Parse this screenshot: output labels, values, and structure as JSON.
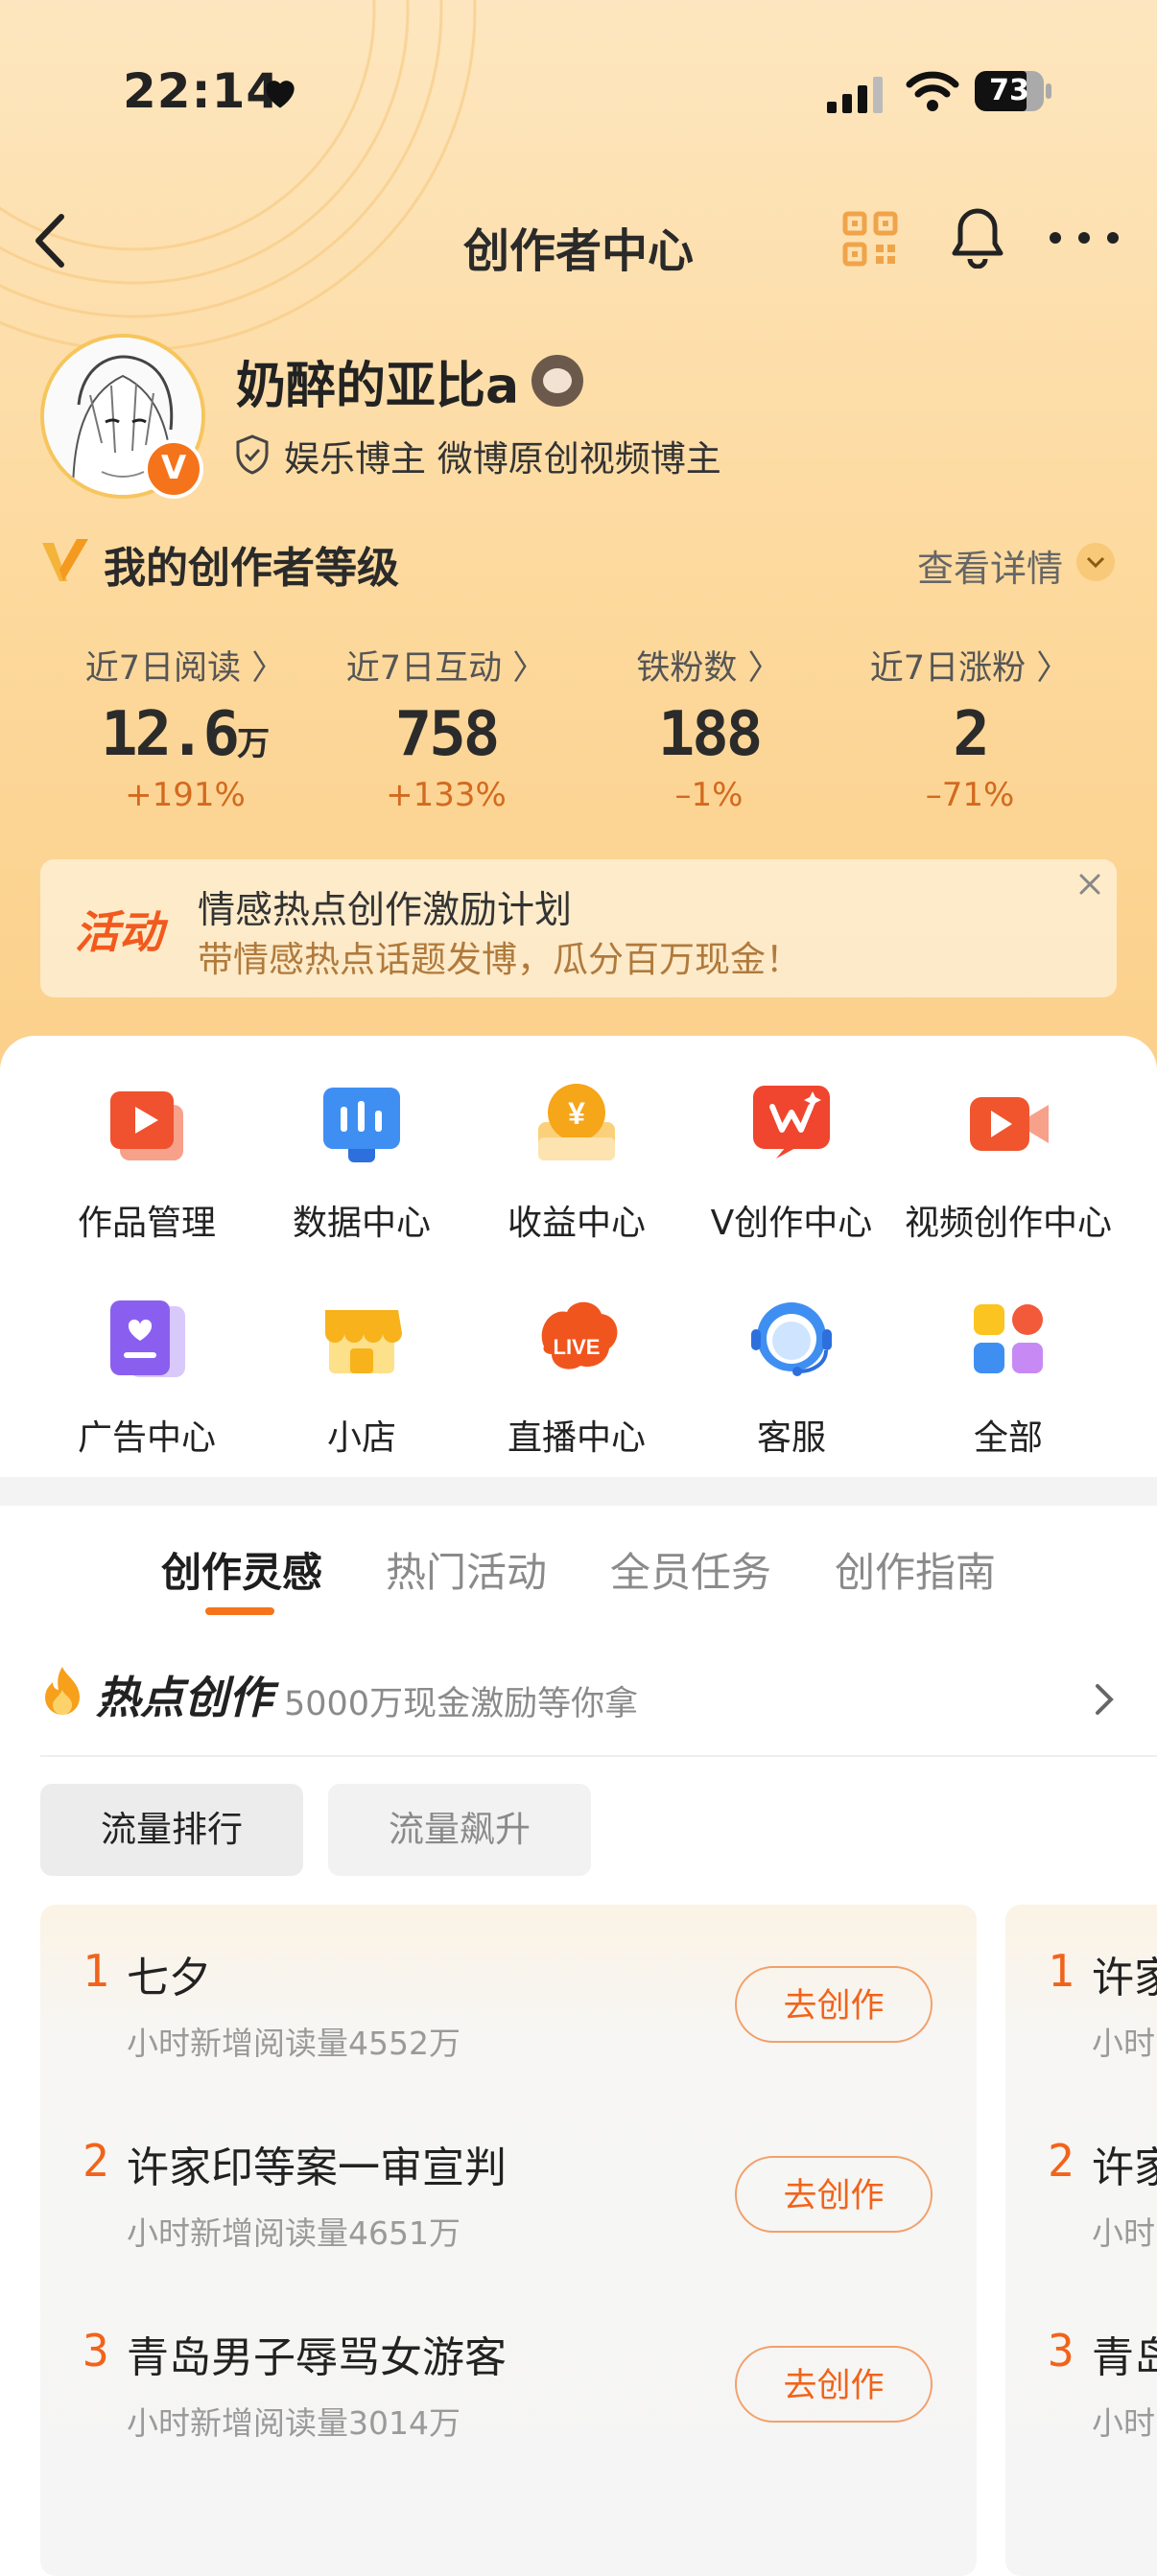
{
  "status_bar": {
    "time": "22:14",
    "battery": "73"
  },
  "nav": {
    "title": "创作者中心"
  },
  "profile": {
    "username": "奶醉的亚比a",
    "verified_badge": "V",
    "tags": "娱乐博主 微博原创视频博主"
  },
  "level": {
    "title": "我的创作者等级",
    "detail_link": "查看详情"
  },
  "stats": [
    {
      "label": "近7日阅读 〉",
      "value": "12.6",
      "unit": "万",
      "change": "+191%"
    },
    {
      "label": "近7日互动 〉",
      "value": "758",
      "unit": "",
      "change": "+133%"
    },
    {
      "label": "铁粉数 〉",
      "value": "188",
      "unit": "",
      "change": "–1%"
    },
    {
      "label": "近7日涨粉 〉",
      "value": "2",
      "unit": "",
      "change": "–71%"
    }
  ],
  "banner": {
    "tag": "活动",
    "title": "情感热点创作激励计划",
    "subtitle": "带情感热点话题发博，瓜分百万现金！"
  },
  "menu": [
    {
      "label": "作品管理",
      "icon": "works-icon"
    },
    {
      "label": "数据中心",
      "icon": "data-icon"
    },
    {
      "label": "收益中心",
      "icon": "income-icon"
    },
    {
      "label": "V创作中心",
      "icon": "v-create-icon"
    },
    {
      "label": "视频创作中心",
      "icon": "video-icon"
    },
    {
      "label": "广告中心",
      "icon": "ad-icon"
    },
    {
      "label": "小店",
      "icon": "shop-icon"
    },
    {
      "label": "直播中心",
      "icon": "live-icon"
    },
    {
      "label": "客服",
      "icon": "service-icon"
    },
    {
      "label": "全部",
      "icon": "all-icon"
    }
  ],
  "tabs": [
    "创作灵感",
    "热门活动",
    "全员任务",
    "创作指南"
  ],
  "hot": {
    "title": "热点创作",
    "subtitle": "5000万现金激励等你拿"
  },
  "chips": [
    "流量排行",
    "流量飙升"
  ],
  "ranking": [
    {
      "rank": "1",
      "title": "七夕",
      "sub": "小时新增阅读量4552万",
      "button": "去创作"
    },
    {
      "rank": "2",
      "title": "许家印等案一审宣判",
      "sub": "小时新增阅读量4651万",
      "button": "去创作"
    },
    {
      "rank": "3",
      "title": "青岛男子辱骂女游客",
      "sub": "小时新增阅读量3014万",
      "button": "去创作"
    }
  ],
  "ranking_peek": [
    {
      "rank": "1",
      "title": "许家",
      "sub": "小时"
    },
    {
      "rank": "2",
      "title": "许家",
      "sub": "小时"
    },
    {
      "rank": "3",
      "title": "青岛",
      "sub": "小时"
    }
  ],
  "colors": {
    "accent": "#f5731b",
    "header_bg": "#fdd99d",
    "rank_red": "#f2631a"
  }
}
